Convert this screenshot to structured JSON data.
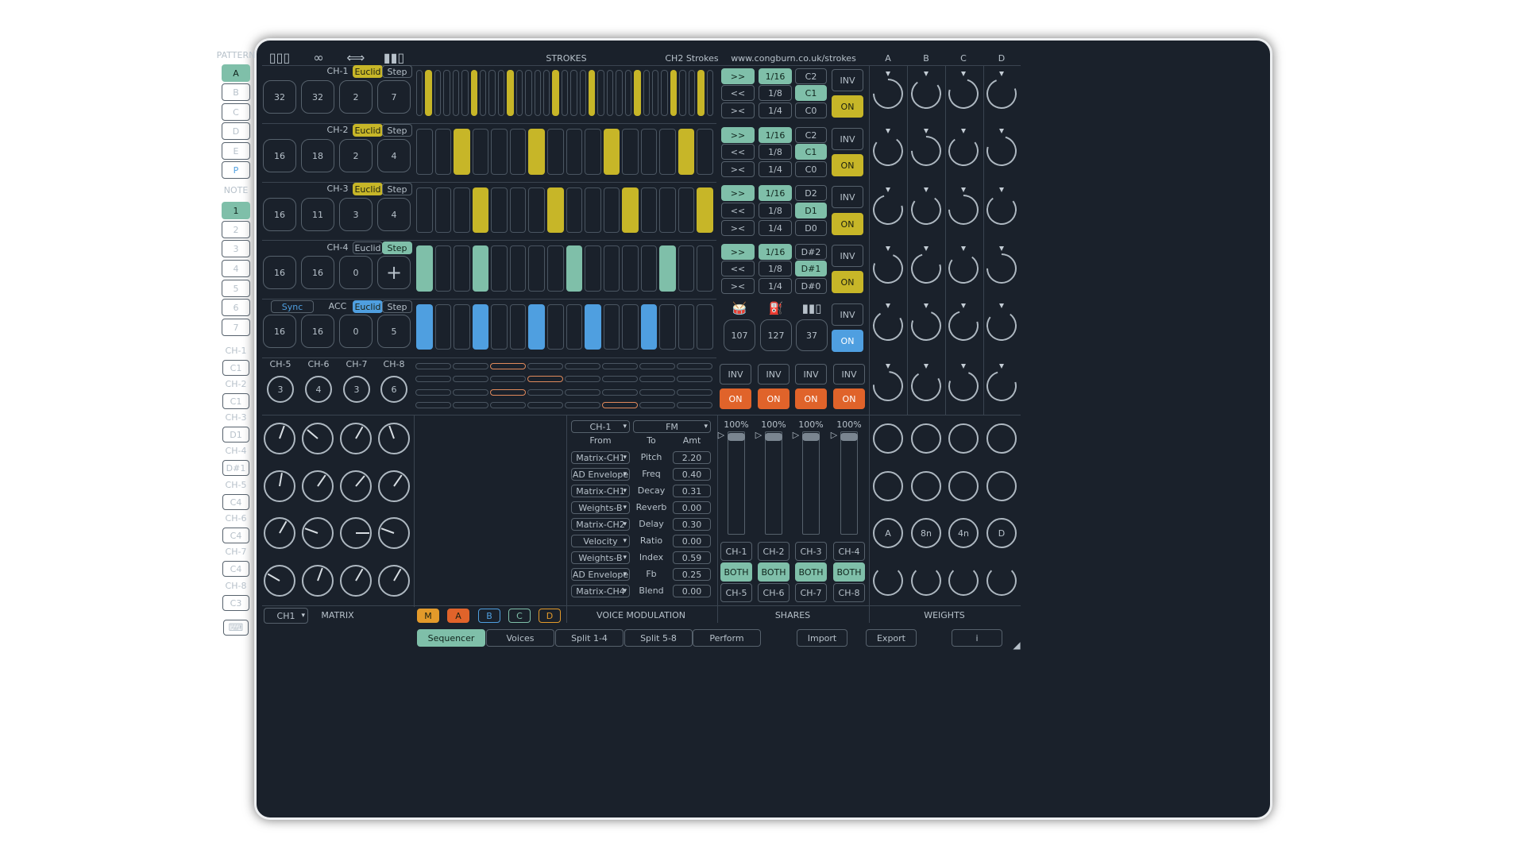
{
  "header": {
    "strokes": "STROKES",
    "preset": "CH2 Strokes",
    "url": "www.congburn.co.uk/strokes",
    "weight_cols": [
      "A",
      "B",
      "C",
      "D"
    ]
  },
  "left": {
    "pattern_label": "PATTERN",
    "patterns": [
      "A",
      "B",
      "C",
      "D",
      "E",
      "P"
    ],
    "note_label": "NOTE",
    "notes": [
      "1",
      "2",
      "3",
      "4",
      "5",
      "6",
      "7"
    ],
    "channels": [
      {
        "label": "CH-1",
        "note": "C1"
      },
      {
        "label": "CH-2",
        "note": "C1"
      },
      {
        "label": "CH-3",
        "note": "D1"
      },
      {
        "label": "CH-4",
        "note": "D#1"
      },
      {
        "label": "CH-5",
        "note": "C4"
      },
      {
        "label": "CH-6",
        "note": "C4"
      },
      {
        "label": "CH-7",
        "note": "C4"
      },
      {
        "label": "CH-8",
        "note": "C3"
      }
    ]
  },
  "seq": {
    "euclid": "Euclid",
    "step": "Step",
    "rows": [
      {
        "label": "CH-1",
        "params": [
          "32",
          "32",
          "2",
          "7"
        ],
        "color": "#c7b628",
        "steps": [
          0,
          1,
          0,
          0,
          0,
          0,
          1,
          0,
          0,
          0,
          1,
          0,
          0,
          0,
          0,
          1,
          0,
          0,
          0,
          1,
          0,
          0,
          0,
          0,
          1,
          0,
          0,
          0,
          1,
          0,
          0,
          1,
          0
        ]
      },
      {
        "label": "CH-2",
        "params": [
          "16",
          "18",
          "2",
          "4"
        ],
        "color": "#c7b628",
        "steps": [
          0,
          0,
          1,
          0,
          0,
          0,
          1,
          0,
          0,
          0,
          1,
          0,
          0,
          0,
          1,
          0
        ]
      },
      {
        "label": "CH-3",
        "params": [
          "16",
          "11",
          "3",
          "4"
        ],
        "color": "#c7b628",
        "steps": [
          0,
          0,
          0,
          1,
          0,
          0,
          0,
          1,
          0,
          0,
          0,
          1,
          0,
          0,
          0,
          1
        ]
      },
      {
        "label": "CH-4",
        "params": [
          "16",
          "16",
          "0",
          "+"
        ],
        "color": "#7fbfa9",
        "steps": [
          1,
          0,
          0,
          1,
          0,
          0,
          0,
          0,
          1,
          0,
          0,
          0,
          0,
          1,
          0,
          0
        ]
      },
      {
        "label": "ACC",
        "sync": "Sync",
        "params": [
          "16",
          "16",
          "0",
          "5"
        ],
        "color": "#4f9fe0",
        "steps": [
          1,
          0,
          0,
          1,
          0,
          0,
          1,
          0,
          0,
          1,
          0,
          0,
          1,
          0,
          0,
          0
        ]
      }
    ],
    "dir": [
      ">>",
      "<<",
      "><"
    ],
    "rates": [
      "1/16",
      "1/8",
      "1/4"
    ],
    "notes": [
      [
        "C2",
        "C1",
        "C0"
      ],
      [
        "C2",
        "C1",
        "C0"
      ],
      [
        "D2",
        "D1",
        "D0"
      ],
      [
        "D#2",
        "D#1",
        "D#0"
      ]
    ],
    "inv": "INV",
    "on": "ON",
    "acc_values": [
      "107",
      "127",
      "37"
    ],
    "mini_channels": [
      {
        "label": "CH-5",
        "value": "3"
      },
      {
        "label": "CH-6",
        "value": "4"
      },
      {
        "label": "CH-7",
        "value": "3"
      },
      {
        "label": "CH-8",
        "value": "6"
      }
    ]
  },
  "matrix": {
    "select": "CH1",
    "label": "MATRIX",
    "tabs": [
      "M",
      "A",
      "B",
      "C",
      "D"
    ]
  },
  "voice_mod": {
    "channel": "CH-1",
    "mode": "FM",
    "from": "From",
    "to": "To",
    "amt": "Amt",
    "rows": [
      {
        "from": "Matrix-CH1",
        "to": "Pitch",
        "amt": "2.20"
      },
      {
        "from": "AD Envelope",
        "to": "Freq",
        "amt": "0.40"
      },
      {
        "from": "Matrix-CH1",
        "to": "Decay",
        "amt": "0.31"
      },
      {
        "from": "Weights-B",
        "to": "Reverb",
        "amt": "0.00"
      },
      {
        "from": "Matrix-CH2",
        "to": "Delay",
        "amt": "0.30"
      },
      {
        "from": "Velocity",
        "to": "Ratio",
        "amt": "0.00"
      },
      {
        "from": "Weights-B",
        "to": "Index",
        "amt": "0.59"
      },
      {
        "from": "AD Envelope",
        "to": "Fb",
        "amt": "0.25"
      },
      {
        "from": "Matrix-CH4",
        "to": "Blend",
        "amt": "0.00"
      }
    ],
    "label": "VOICE MODULATION"
  },
  "shares": {
    "label": "SHARES",
    "pct": "100%",
    "top": [
      "CH-1",
      "CH-2",
      "CH-3",
      "CH-4"
    ],
    "both": "BOTH",
    "bottom": [
      "CH-5",
      "CH-6",
      "CH-7",
      "CH-8"
    ]
  },
  "weights": {
    "label": "WEIGHTS",
    "knob_labels": [
      "A",
      "8n",
      "4n",
      "D"
    ]
  },
  "nav": {
    "tabs": [
      "Sequencer",
      "Voices",
      "Split 1-4",
      "Split 5-8",
      "Perform"
    ],
    "import": "Import",
    "export": "Export",
    "info": "i"
  },
  "colors": {
    "bg": "#1a212b",
    "yellow": "#c7b628",
    "teal": "#7fbfa9",
    "blue": "#4f9fe0",
    "orange": "#e0632a"
  }
}
